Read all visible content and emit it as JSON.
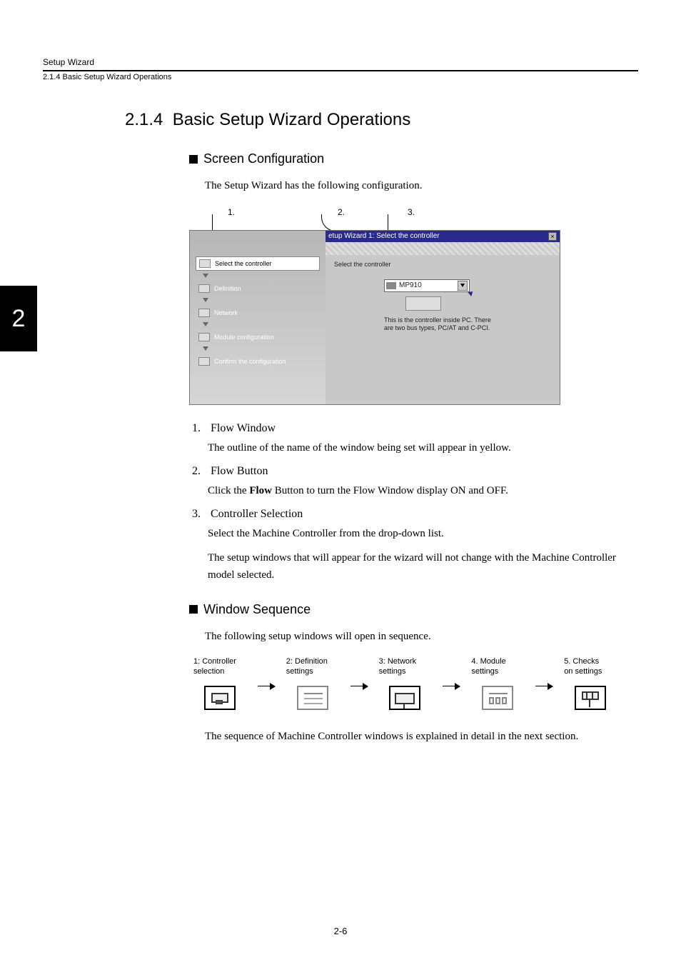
{
  "header": {
    "chapter": "Setup Wizard",
    "breadcrumb": "2.1.4  Basic Setup Wizard Operations",
    "tab": "2"
  },
  "section": {
    "number": "2.1.4",
    "title": "Basic Setup Wizard Operations"
  },
  "subsections": {
    "screen_config": {
      "title": "Screen Configuration",
      "intro": "The Setup Wizard has the following configuration.",
      "callouts": {
        "c1": "1.",
        "c2": "2.",
        "c3": "3."
      }
    },
    "window_seq": {
      "title": "Window Sequence",
      "intro": "The following setup windows will open in sequence.",
      "closing": "The sequence of Machine Controller windows is explained in detail in the next section."
    }
  },
  "screenshot": {
    "titlebar": "etup Wizard  1: Select the controller",
    "left_steps": [
      "Select the controller",
      "Definition",
      "Network",
      "Module configuration",
      "Confirm the configuration"
    ],
    "right": {
      "label": "Select the controller",
      "dropdown_value": "MP910",
      "desc": "This is the controller inside PC. There are two bus types, PC/AT and C-PCI."
    }
  },
  "list": {
    "i1": {
      "num": "1.",
      "title": "Flow Window",
      "body": "The outline of the name of the window being set will appear in yellow."
    },
    "i2": {
      "num": "2.",
      "title": "Flow Button",
      "body_pre": "Click the ",
      "body_bold": "Flow",
      "body_post": " Button to turn the Flow Window display ON and OFF."
    },
    "i3": {
      "num": "3.",
      "title": "Controller Selection",
      "body1": "Select the Machine Controller from the drop-down list.",
      "body2": "The setup windows that will appear for the wizard will not change with the Machine Controller model selected."
    }
  },
  "sequence": [
    {
      "line1": "1: Controller",
      "line2": "selection"
    },
    {
      "line1": "2: Definition",
      "line2": "settings"
    },
    {
      "line1": "3: Network",
      "line2": "settings"
    },
    {
      "line1": "4. Module",
      "line2": "settings"
    },
    {
      "line1": "5. Checks",
      "line2": "on settings"
    }
  ],
  "footer": {
    "page": "2-6"
  }
}
